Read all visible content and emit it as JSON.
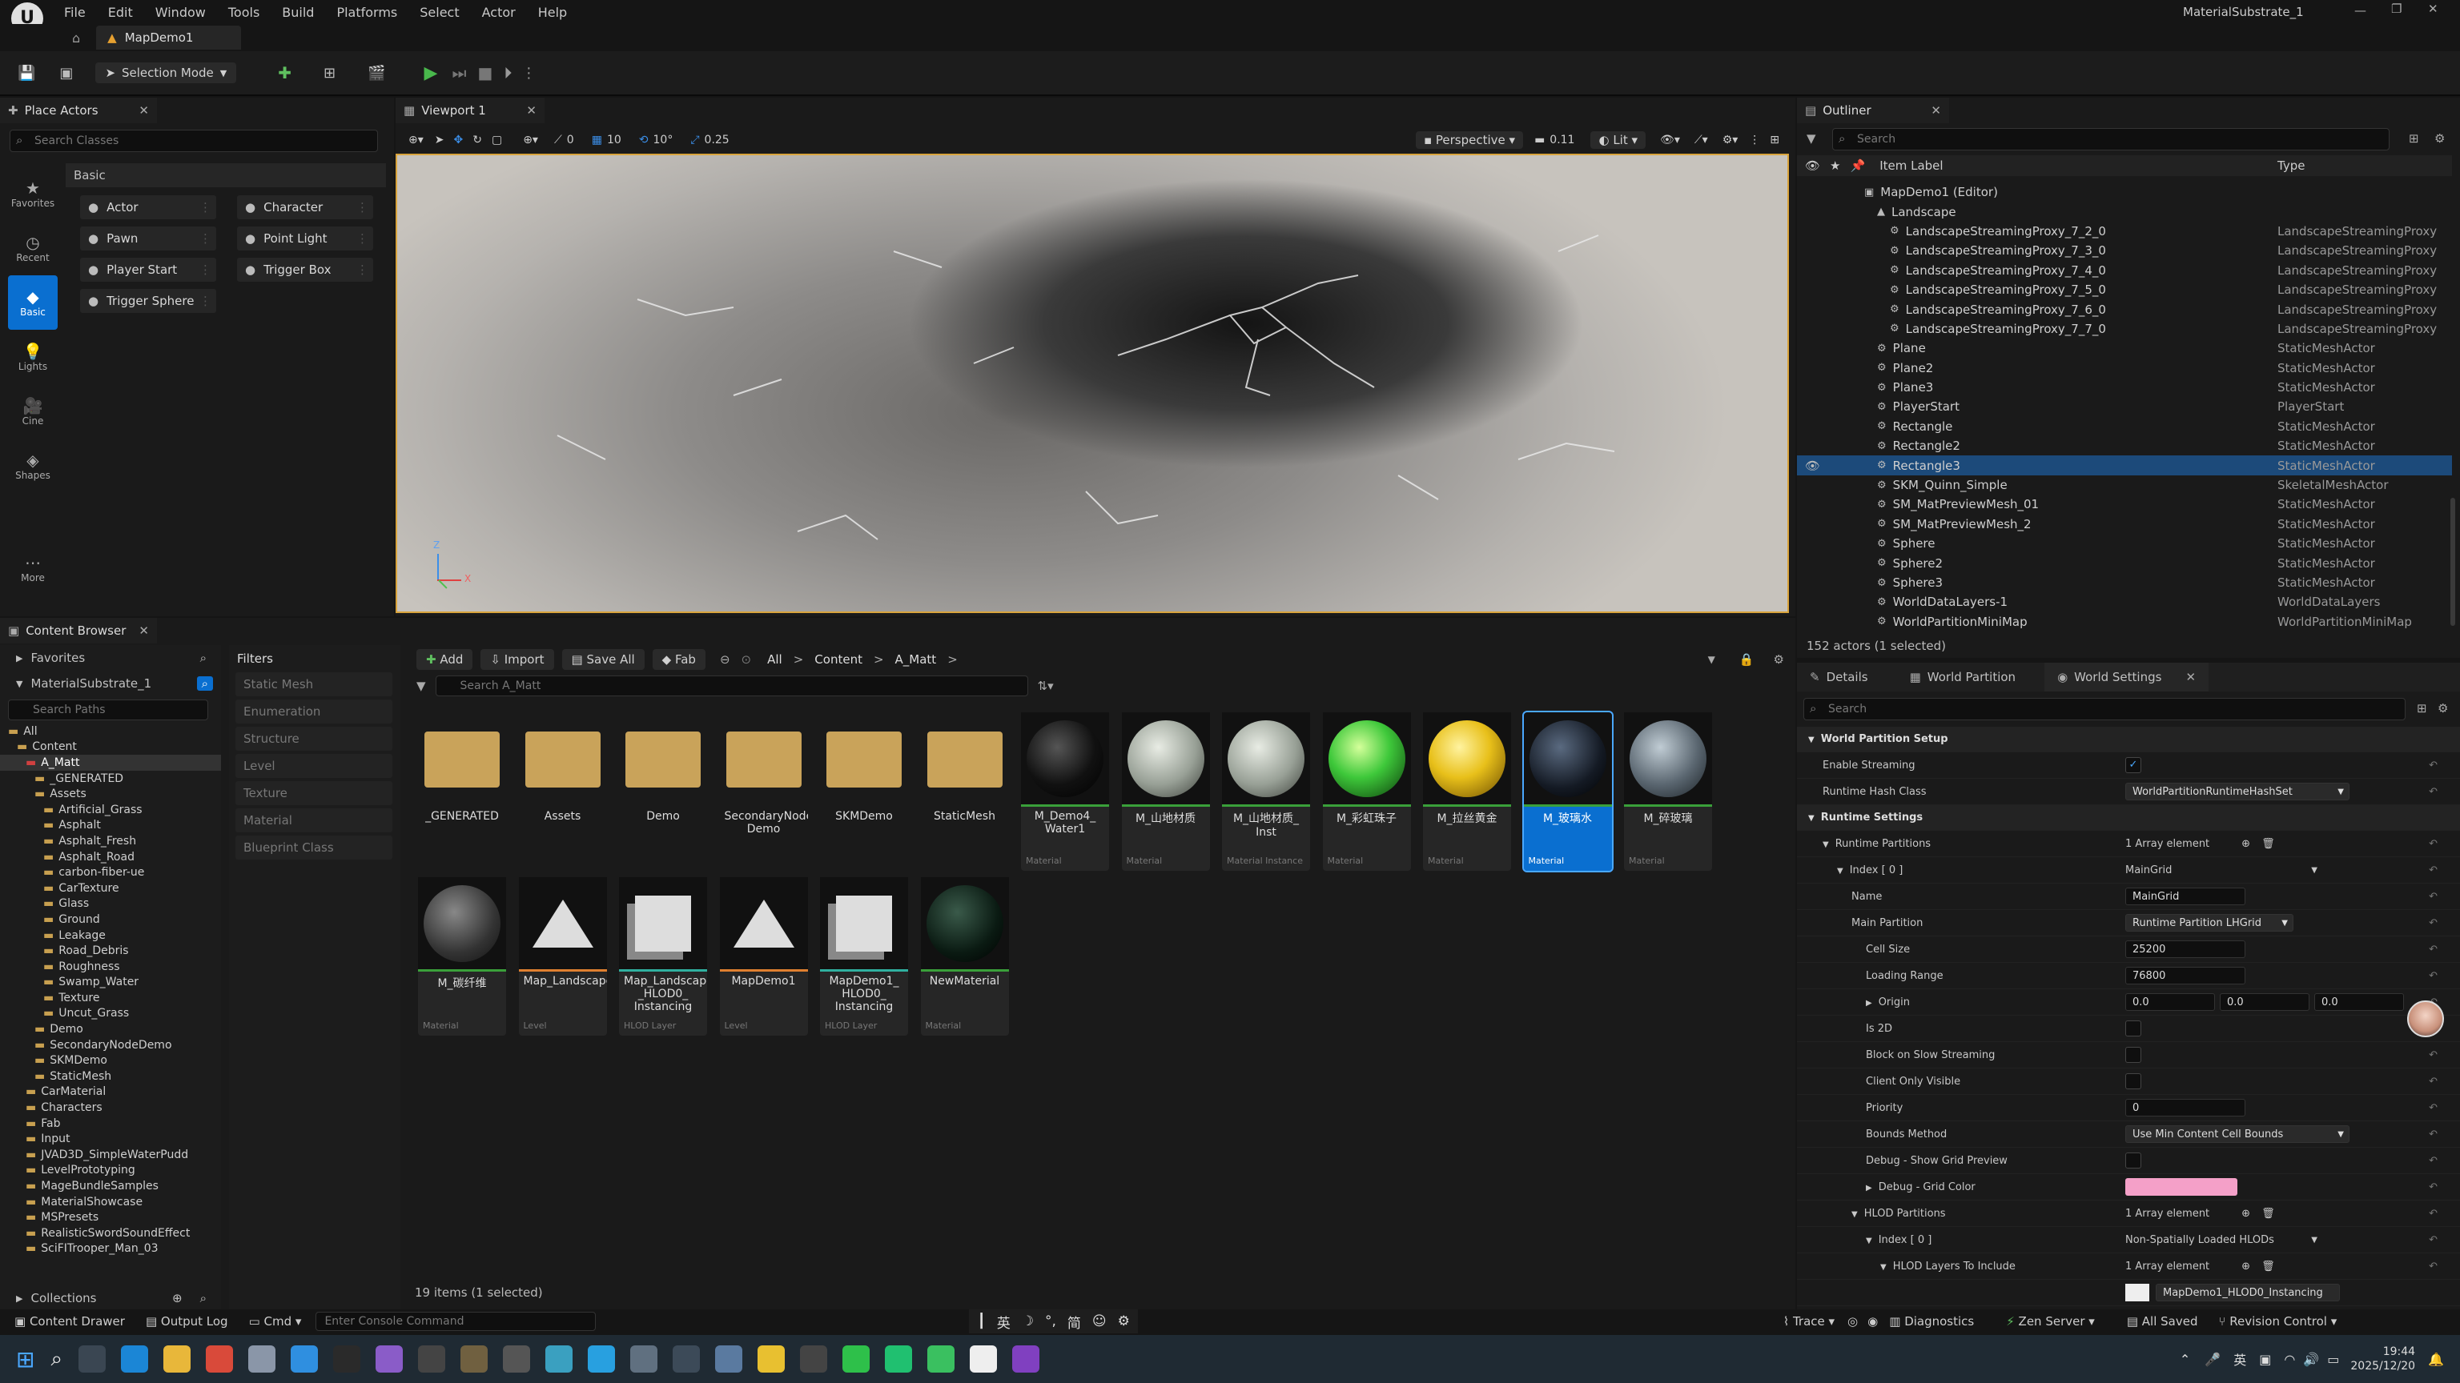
{
  "titlebar": {
    "menu": [
      "File",
      "Edit",
      "Window",
      "Tools",
      "Build",
      "Platforms",
      "Select",
      "Actor",
      "Help"
    ],
    "project": "MaterialSubstrate_1"
  },
  "tab": {
    "level": "MapDemo1"
  },
  "toolbar": {
    "selection_mode": "Selection Mode"
  },
  "place_actors": {
    "title": "Place Actors",
    "search_placeholder": "Search Classes",
    "category": "Basic",
    "side": [
      "Favorites",
      "Recent",
      "Basic",
      "Lights",
      "Cine",
      "Shapes",
      "More"
    ],
    "items": [
      [
        "Actor",
        "Character"
      ],
      [
        "Pawn",
        "Point Light"
      ],
      [
        "Player Start",
        "Trigger Box"
      ],
      [
        "Trigger Sphere",
        ""
      ]
    ]
  },
  "viewport": {
    "title": "Viewport 1",
    "perspective": "Perspective",
    "lit": "Lit",
    "snap_translate": "10",
    "snap_rotate": "10°",
    "snap_scale": "0.25",
    "camera_speed": "0.11",
    "axis_x": "X",
    "axis_z": "Z",
    "zero": "0"
  },
  "outliner": {
    "title": "Outliner",
    "search_placeholder": "Search",
    "col_label": "Item Label",
    "col_type": "Type",
    "rows": [
      {
        "label": "MapDemo1 (Editor)",
        "type": "",
        "indent": 0
      },
      {
        "label": "Landscape",
        "type": "",
        "indent": 1
      },
      {
        "label": "LandscapeStreamingProxy_7_2_0",
        "type": "LandscapeStreamingProxy",
        "indent": 2
      },
      {
        "label": "LandscapeStreamingProxy_7_3_0",
        "type": "LandscapeStreamingProxy",
        "indent": 2
      },
      {
        "label": "LandscapeStreamingProxy_7_4_0",
        "type": "LandscapeStreamingProxy",
        "indent": 2
      },
      {
        "label": "LandscapeStreamingProxy_7_5_0",
        "type": "LandscapeStreamingProxy",
        "indent": 2
      },
      {
        "label": "LandscapeStreamingProxy_7_6_0",
        "type": "LandscapeStreamingProxy",
        "indent": 2
      },
      {
        "label": "LandscapeStreamingProxy_7_7_0",
        "type": "LandscapeStreamingProxy",
        "indent": 2
      },
      {
        "label": "Plane",
        "type": "StaticMeshActor",
        "indent": 1
      },
      {
        "label": "Plane2",
        "type": "StaticMeshActor",
        "indent": 1
      },
      {
        "label": "Plane3",
        "type": "StaticMeshActor",
        "indent": 1
      },
      {
        "label": "PlayerStart",
        "type": "PlayerStart",
        "indent": 1
      },
      {
        "label": "Rectangle",
        "type": "StaticMeshActor",
        "indent": 1
      },
      {
        "label": "Rectangle2",
        "type": "StaticMeshActor",
        "indent": 1
      },
      {
        "label": "Rectangle3",
        "type": "StaticMeshActor",
        "indent": 1,
        "selected": true
      },
      {
        "label": "SKM_Quinn_Simple",
        "type": "SkeletalMeshActor",
        "indent": 1
      },
      {
        "label": "SM_MatPreviewMesh_01",
        "type": "StaticMeshActor",
        "indent": 1
      },
      {
        "label": "SM_MatPreviewMesh_2",
        "type": "StaticMeshActor",
        "indent": 1
      },
      {
        "label": "Sphere",
        "type": "StaticMeshActor",
        "indent": 1
      },
      {
        "label": "Sphere2",
        "type": "StaticMeshActor",
        "indent": 1
      },
      {
        "label": "Sphere3",
        "type": "StaticMeshActor",
        "indent": 1
      },
      {
        "label": "WorldDataLayers-1",
        "type": "WorldDataLayers",
        "indent": 1
      },
      {
        "label": "WorldPartitionMiniMap",
        "type": "WorldPartitionMiniMap",
        "indent": 1
      }
    ],
    "status": "152 actors (1 selected)"
  },
  "content_browser": {
    "title": "Content Browser",
    "favorites": "Favorites",
    "project": "MaterialSubstrate_1",
    "search_paths": "Search Paths",
    "filters": "Filters",
    "add": "Add",
    "import": "Import",
    "save_all": "Save All",
    "fab": "Fab",
    "breadcrumb": [
      "All",
      "Content",
      "A_Matt"
    ],
    "search_placeholder": "Search A_Matt",
    "filter_items": [
      "Static Mesh",
      "Enumeration",
      "Structure",
      "Level",
      "Texture",
      "Material",
      "Blueprint Class"
    ],
    "tree": [
      {
        "label": "All",
        "indent": 0
      },
      {
        "label": "Content",
        "indent": 1
      },
      {
        "label": "A_Matt",
        "indent": 2,
        "selected": true
      },
      {
        "label": "_GENERATED",
        "indent": 3
      },
      {
        "label": "Assets",
        "indent": 3
      },
      {
        "label": "Artificial_Grass",
        "indent": 4
      },
      {
        "label": "Asphalt",
        "indent": 4
      },
      {
        "label": "Asphalt_Fresh",
        "indent": 4
      },
      {
        "label": "Asphalt_Road",
        "indent": 4
      },
      {
        "label": "carbon-fiber-ue",
        "indent": 4
      },
      {
        "label": "CarTexture",
        "indent": 4
      },
      {
        "label": "Glass",
        "indent": 4
      },
      {
        "label": "Ground",
        "indent": 4
      },
      {
        "label": "Leakage",
        "indent": 4
      },
      {
        "label": "Road_Debris",
        "indent": 4
      },
      {
        "label": "Roughness",
        "indent": 4
      },
      {
        "label": "Swamp_Water",
        "indent": 4
      },
      {
        "label": "Texture",
        "indent": 4
      },
      {
        "label": "Uncut_Grass",
        "indent": 4
      },
      {
        "label": "Demo",
        "indent": 3
      },
      {
        "label": "SecondaryNodeDemo",
        "indent": 3
      },
      {
        "label": "SKMDemo",
        "indent": 3
      },
      {
        "label": "StaticMesh",
        "indent": 3
      },
      {
        "label": "CarMaterial",
        "indent": 2
      },
      {
        "label": "Characters",
        "indent": 2
      },
      {
        "label": "Fab",
        "indent": 2
      },
      {
        "label": "Input",
        "indent": 2
      },
      {
        "label": "JVAD3D_SimpleWaterPudd",
        "indent": 2
      },
      {
        "label": "LevelPrototyping",
        "indent": 2
      },
      {
        "label": "MageBundleSamples",
        "indent": 2
      },
      {
        "label": "MaterialShowcase",
        "indent": 2
      },
      {
        "label": "MSPresets",
        "indent": 2
      },
      {
        "label": "RealisticSwordSoundEffect",
        "indent": 2
      },
      {
        "label": "SciFITrooper_Man_03",
        "indent": 2
      }
    ],
    "collections": "Collections",
    "assets_row1": [
      {
        "name": "_GENERATED",
        "type": "",
        "kind": "folder"
      },
      {
        "name": "Assets",
        "type": "",
        "kind": "folder"
      },
      {
        "name": "Demo",
        "type": "",
        "kind": "folder"
      },
      {
        "name": "SecondaryNode Demo",
        "type": "",
        "kind": "folder"
      },
      {
        "name": "SKMDemo",
        "type": "",
        "kind": "folder"
      },
      {
        "name": "StaticMesh",
        "type": "",
        "kind": "folder"
      },
      {
        "name": "M_Demo4_ Water1",
        "type": "Material",
        "kind": "dark"
      },
      {
        "name": "M_山地材质",
        "type": "Material",
        "kind": "rock"
      },
      {
        "name": "M_山地材质_ Inst",
        "type": "Material Instance",
        "kind": "rock"
      },
      {
        "name": "M_彩虹珠子",
        "type": "Material",
        "kind": "green"
      },
      {
        "name": "M_拉丝黄金",
        "type": "Material",
        "kind": "gold"
      },
      {
        "name": "M_玻璃水",
        "type": "Material",
        "kind": "glass",
        "selected": true
      },
      {
        "name": "M_碎玻璃",
        "type": "Material",
        "kind": "clear"
      }
    ],
    "assets_row2": [
      {
        "name": "M_碳纤维",
        "type": "Material",
        "kind": "fiber"
      },
      {
        "name": "Map_Landscape",
        "type": "Level",
        "kind": "level"
      },
      {
        "name": "Map_Landscape _HLOD0_ Instancing",
        "type": "HLOD Layer",
        "kind": "hlod"
      },
      {
        "name": "MapDemo1",
        "type": "Level",
        "kind": "level"
      },
      {
        "name": "MapDemo1_ HLOD0_ Instancing",
        "type": "HLOD Layer",
        "kind": "hlod"
      },
      {
        "name": "NewMaterial",
        "type": "Material",
        "kind": "dark2"
      }
    ],
    "status": "19 items (1 selected)"
  },
  "details": {
    "tabs": [
      "Details",
      "World Partition",
      "World Settings"
    ],
    "search_placeholder": "Search",
    "rows": [
      {
        "label": "World Partition Setup",
        "value": "",
        "kind": "section",
        "indent": 0
      },
      {
        "label": "Enable Streaming",
        "value": "",
        "kind": "check_on",
        "indent": 1
      },
      {
        "label": "Runtime Hash Class",
        "value": "WorldPartitionRuntimeHashSet",
        "kind": "combo",
        "indent": 1
      },
      {
        "label": "Runtime Settings",
        "value": "",
        "kind": "section",
        "indent": 0
      },
      {
        "label": "Runtime Partitions",
        "value": "1 Array element",
        "kind": "array",
        "indent": 1
      },
      {
        "label": "Index [ 0 ]",
        "value": "MainGrid",
        "kind": "text",
        "indent": 2
      },
      {
        "label": "Name",
        "value": "MainGrid",
        "kind": "field",
        "indent": 3
      },
      {
        "label": "Main Partition",
        "value": "Runtime Partition LHGrid",
        "kind": "combo",
        "indent": 3
      },
      {
        "label": "Cell Size",
        "value": "25200",
        "kind": "field",
        "indent": 4
      },
      {
        "label": "Loading Range",
        "value": "76800",
        "kind": "field",
        "indent": 4
      },
      {
        "label": "Origin",
        "value": "0.0",
        "kind": "vec",
        "indent": 4
      },
      {
        "label": "Is 2D",
        "value": "",
        "kind": "check",
        "indent": 4
      },
      {
        "label": "Block on Slow Streaming",
        "value": "",
        "kind": "check",
        "indent": 4
      },
      {
        "label": "Client Only Visible",
        "value": "",
        "kind": "check",
        "indent": 4
      },
      {
        "label": "Priority",
        "value": "0",
        "kind": "field",
        "indent": 4
      },
      {
        "label": "Bounds Method",
        "value": "Use Min Content Cell Bounds",
        "kind": "combo",
        "indent": 4
      },
      {
        "label": "Debug - Show Grid Preview",
        "value": "",
        "kind": "check",
        "indent": 4
      },
      {
        "label": "Debug - Grid Color",
        "value": "",
        "kind": "color",
        "indent": 4
      },
      {
        "label": "HLOD Partitions",
        "value": "1 Array element",
        "kind": "array",
        "indent": 3
      },
      {
        "label": "Index [ 0 ]",
        "value": "Non-Spatially Loaded HLODs",
        "kind": "text",
        "indent": 4
      },
      {
        "label": "HLOD Layers To Include",
        "value": "1 Array element",
        "kind": "array",
        "indent": 5
      }
    ],
    "bottom_value": "MapDemo1_HLOD0_Instancing"
  },
  "statusbar": {
    "content_drawer": "Content Drawer",
    "output_log": "Output Log",
    "cmd": "Cmd",
    "console_placeholder": "Enter Console Command",
    "trace": "Trace",
    "diagnostics": "Diagnostics",
    "zen_server": "Zen Server",
    "all_saved": "All Saved",
    "revision_control": "Revision Control"
  },
  "ime": {
    "lang": "英",
    "simp": "简"
  },
  "taskbar": {
    "time": "19:44",
    "date": "2025/12/20",
    "ime": "英"
  },
  "colors": {
    "accent": "#0a6fd0",
    "selected_row": "#1c4a7a",
    "grid_color": "#f4a0c8",
    "play": "#49b84c"
  }
}
